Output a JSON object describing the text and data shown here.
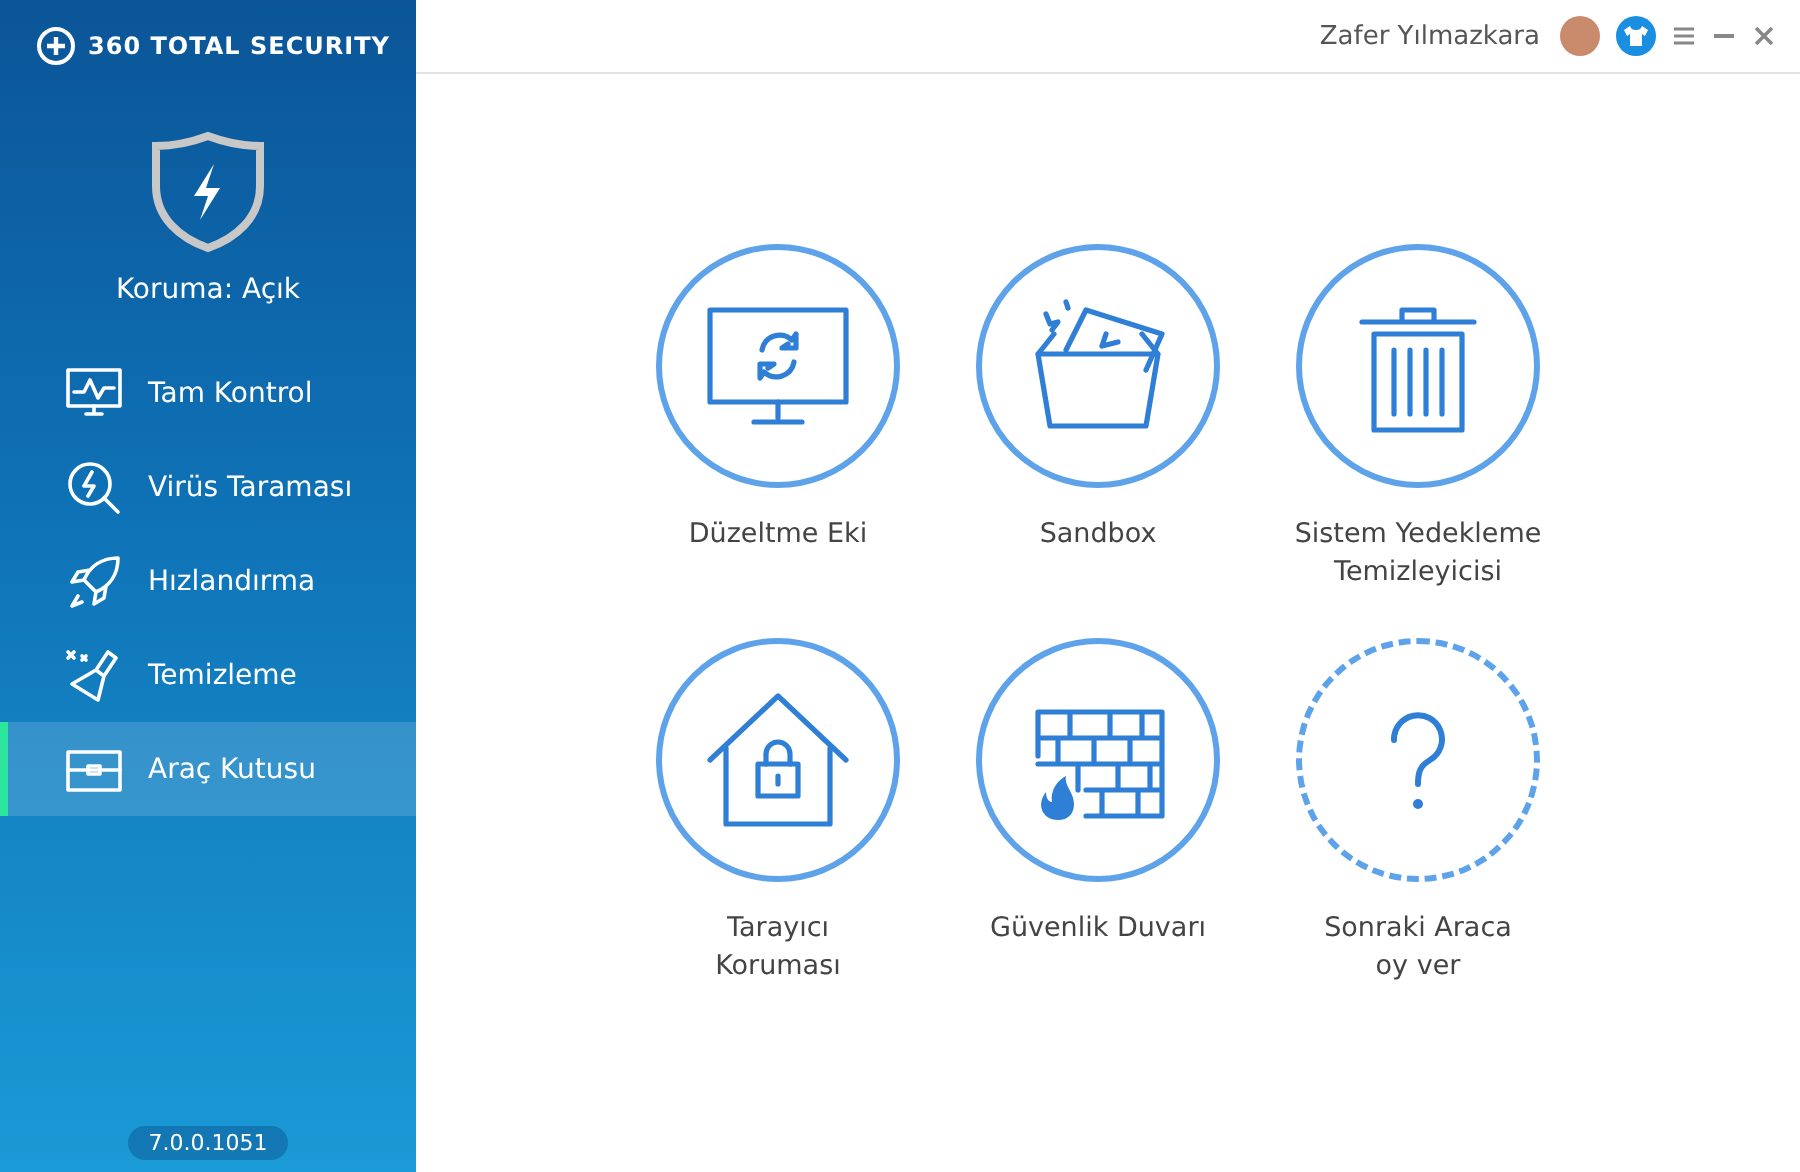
{
  "app": {
    "logo_text": "360 TOTAL SECURITY"
  },
  "protection": {
    "status": "Koruma: Açık"
  },
  "sidebar": {
    "items": [
      {
        "label": "Tam Kontrol",
        "selected": false
      },
      {
        "label": "Virüs Taraması",
        "selected": false
      },
      {
        "label": "Hızlandırma",
        "selected": false
      },
      {
        "label": "Temizleme",
        "selected": false
      },
      {
        "label": "Araç Kutusu",
        "selected": true
      }
    ]
  },
  "version": "7.0.0.1051",
  "header": {
    "user_name": "Zafer Yılmazkara"
  },
  "tools": [
    {
      "label": "Düzeltme Eki",
      "kind": "tool"
    },
    {
      "label": "Sandbox",
      "kind": "tool"
    },
    {
      "label": "Sistem Yedekleme Temizleyicisi",
      "kind": "tool"
    },
    {
      "label": "Tarayıcı Koruması",
      "kind": "tool"
    },
    {
      "label": "Güvenlik Duvarı",
      "kind": "tool"
    },
    {
      "label": "Sonraki Araca oy ver",
      "kind": "vote"
    }
  ]
}
